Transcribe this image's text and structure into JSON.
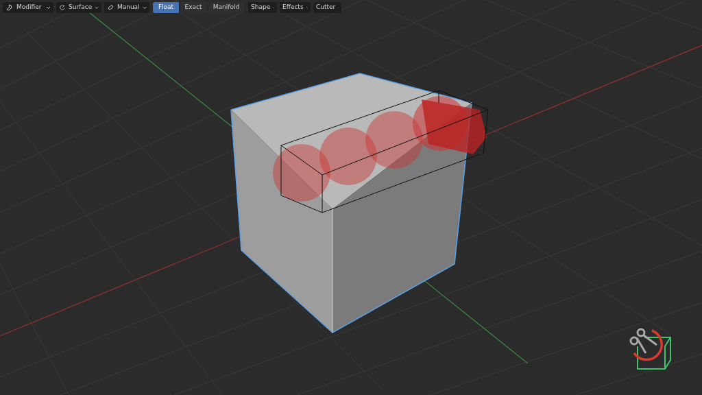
{
  "toolbar": {
    "dropdowns": [
      {
        "kind": "modifier",
        "label": "Modifier"
      },
      {
        "kind": "surface",
        "label": "Surface"
      },
      {
        "kind": "manual",
        "label": "Manual"
      }
    ],
    "modes": [
      {
        "label": "Float",
        "selected": true
      },
      {
        "label": "Exact",
        "selected": false
      },
      {
        "label": "Manifold",
        "selected": false
      }
    ],
    "menus": [
      {
        "label": "Shape"
      },
      {
        "label": "Effects"
      },
      {
        "label": "Cutter"
      }
    ]
  }
}
